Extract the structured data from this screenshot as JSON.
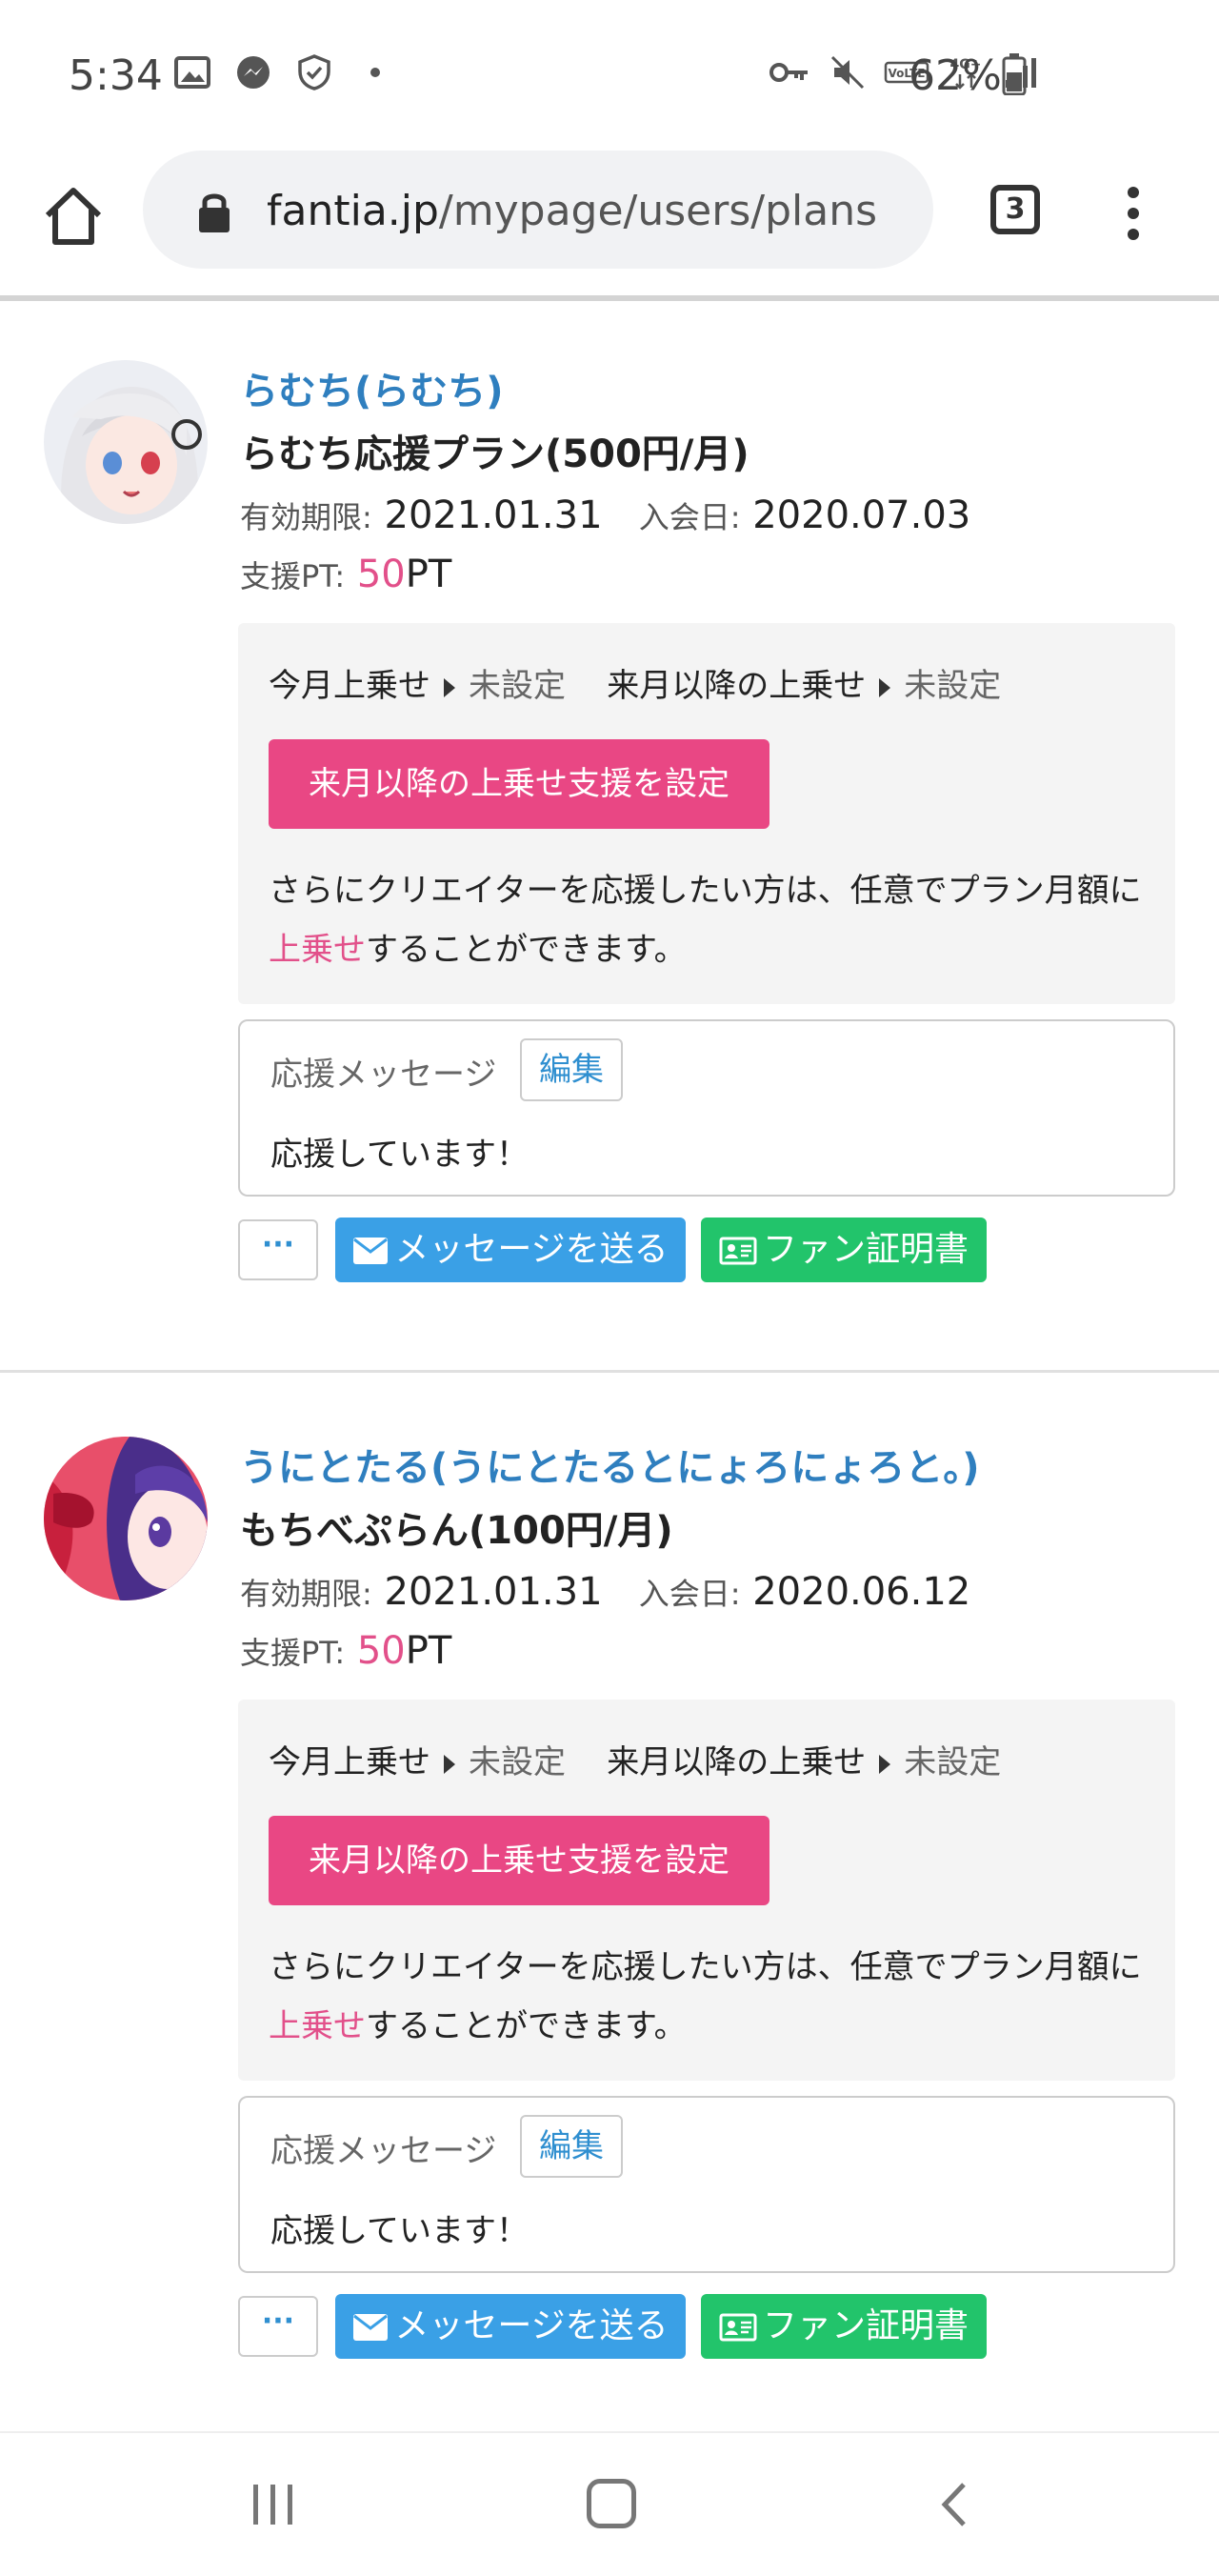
{
  "status_bar": {
    "time": "5:34",
    "battery": "62%",
    "icons_left": [
      "image-icon",
      "messenger-icon",
      "shield-check-icon",
      "dot-icon"
    ],
    "icons_right": [
      "key-icon",
      "mute-icon",
      "volte-icon",
      "4g-plus-icon",
      "signal-icon",
      "battery-icon"
    ]
  },
  "browser": {
    "url_host": "fantia.jp",
    "url_path": "/mypage/users/plans",
    "tab_count": "3"
  },
  "plans": [
    {
      "creator": "らむち(らむち)",
      "plan": "らむち応援プラン(500円/月)",
      "expiry_label": "有効期限:",
      "expiry": "2021.01.31",
      "joined_label": "入会日:",
      "joined": "2020.07.03",
      "pt_label": "支援PT:",
      "pt_value": "50",
      "pt_unit": "PT",
      "this_month_label": "今月上乗せ",
      "this_month_value": "未設定",
      "next_month_label": "来月以降の上乗せ",
      "next_month_value": "未設定",
      "addon_button": "来月以降の上乗せ支援を設定",
      "desc_part1": "さらにクリエイターを応援したい方は、任意でプラン月額に",
      "desc_highlight": "上乗せ",
      "desc_part2": "することができます。",
      "message_label": "応援メッセージ",
      "edit_button": "編集",
      "message": "応援しています！",
      "more_button": "···",
      "send_button": "メッセージを送る",
      "cert_button": "ファン証明書"
    },
    {
      "creator": "うにとたる(うにとたるとにょろにょろと。)",
      "plan": "もちべぷらん(100円/月)",
      "expiry_label": "有効期限:",
      "expiry": "2021.01.31",
      "joined_label": "入会日:",
      "joined": "2020.06.12",
      "pt_label": "支援PT:",
      "pt_value": "50",
      "pt_unit": "PT",
      "this_month_label": "今月上乗せ",
      "this_month_value": "未設定",
      "next_month_label": "来月以降の上乗せ",
      "next_month_value": "未設定",
      "addon_button": "来月以降の上乗せ支援を設定",
      "desc_part1": "さらにクリエイターを応援したい方は、任意でプラン月額に",
      "desc_highlight": "上乗せ",
      "desc_part2": "することができます。",
      "message_label": "応援メッセージ",
      "edit_button": "編集",
      "message": "応援しています！",
      "more_button": "···",
      "send_button": "メッセージを送る",
      "cert_button": "ファン証明書"
    }
  ],
  "colors": {
    "creator_link": "#2f7fbf",
    "accent_pink": "#e94784",
    "send_blue": "#3aa0e6",
    "cert_green": "#22c46b"
  }
}
